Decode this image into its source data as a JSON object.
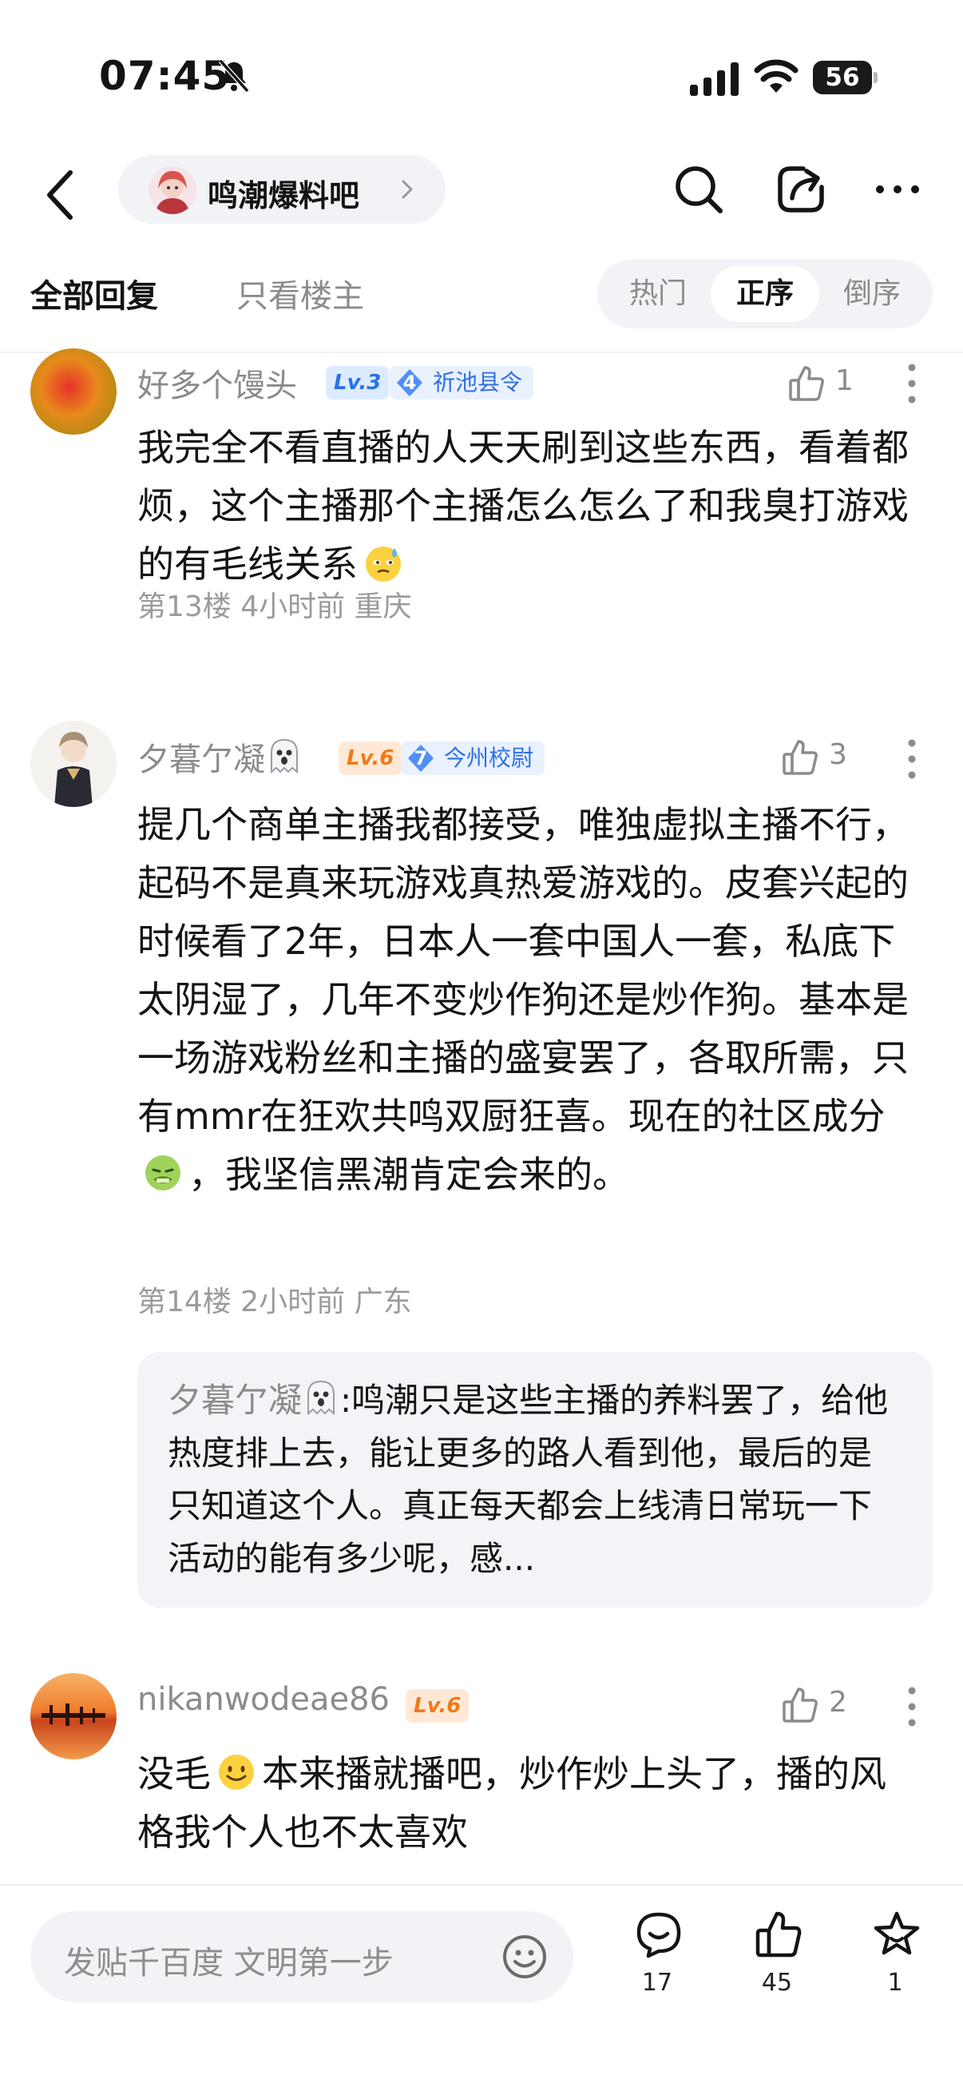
{
  "status_bar": {
    "time": "07:45",
    "battery": "56"
  },
  "nav": {
    "forum_name": "鸣潮爆料吧"
  },
  "filter": {
    "tab_all": "全部回复",
    "tab_op": "只看楼主",
    "sort_options": [
      "热门",
      "正序",
      "倒序"
    ],
    "sort_selected": "正序"
  },
  "posts": [
    {
      "username": "好多个馒头",
      "level": "Lv.3",
      "title_level": "4",
      "title": "祈池县令",
      "likes": "1",
      "content": "我完全不看直播的人天天刷到这些东西，看着都烦，这个主播那个主播怎么怎么了和我臭打游戏的有毛线关系",
      "floor": "第13楼",
      "time": "4小时前",
      "location": "重庆"
    },
    {
      "username": "夕暮亇凝",
      "level": "Lv.6",
      "title_level": "7",
      "title": "今州校尉",
      "likes": "3",
      "content_a": "提几个商单主播我都接受，唯独虚拟主播不行，起码不是真来玩游戏真热爱游戏的。皮套兴起的时候看了2年，日本人一套中国人一套，私底下太阴湿了，几年不变炒作狗还是炒作狗。基本是一场游戏粉丝和主播的盛宴罢了，各取所需，只有mmr在狂欢共鸣双厨狂喜。现在的社区成分",
      "content_b": "，我坚信黑潮肯定会来的。",
      "floor": "第14楼",
      "time": "2小时前",
      "location": "广东",
      "reply": {
        "name": "夕暮亇凝",
        "text": ":鸣潮只是这些主播的养料罢了，给他热度排上去，能让更多的路人看到他，最后的是只知道这个人。真正每天都会上线清日常玩一下活动的能有多少呢，感..."
      }
    },
    {
      "username": "nikanwodeae86",
      "level": "Lv.6",
      "likes": "2",
      "content_a": "没毛",
      "content_b": "本来播就播吧，炒作炒上头了，播的风格我个人也不太喜欢"
    }
  ],
  "bottom_bar": {
    "placeholder": "发贴千百度 文明第一步",
    "comments": "17",
    "likes": "45",
    "favorites": "1"
  }
}
